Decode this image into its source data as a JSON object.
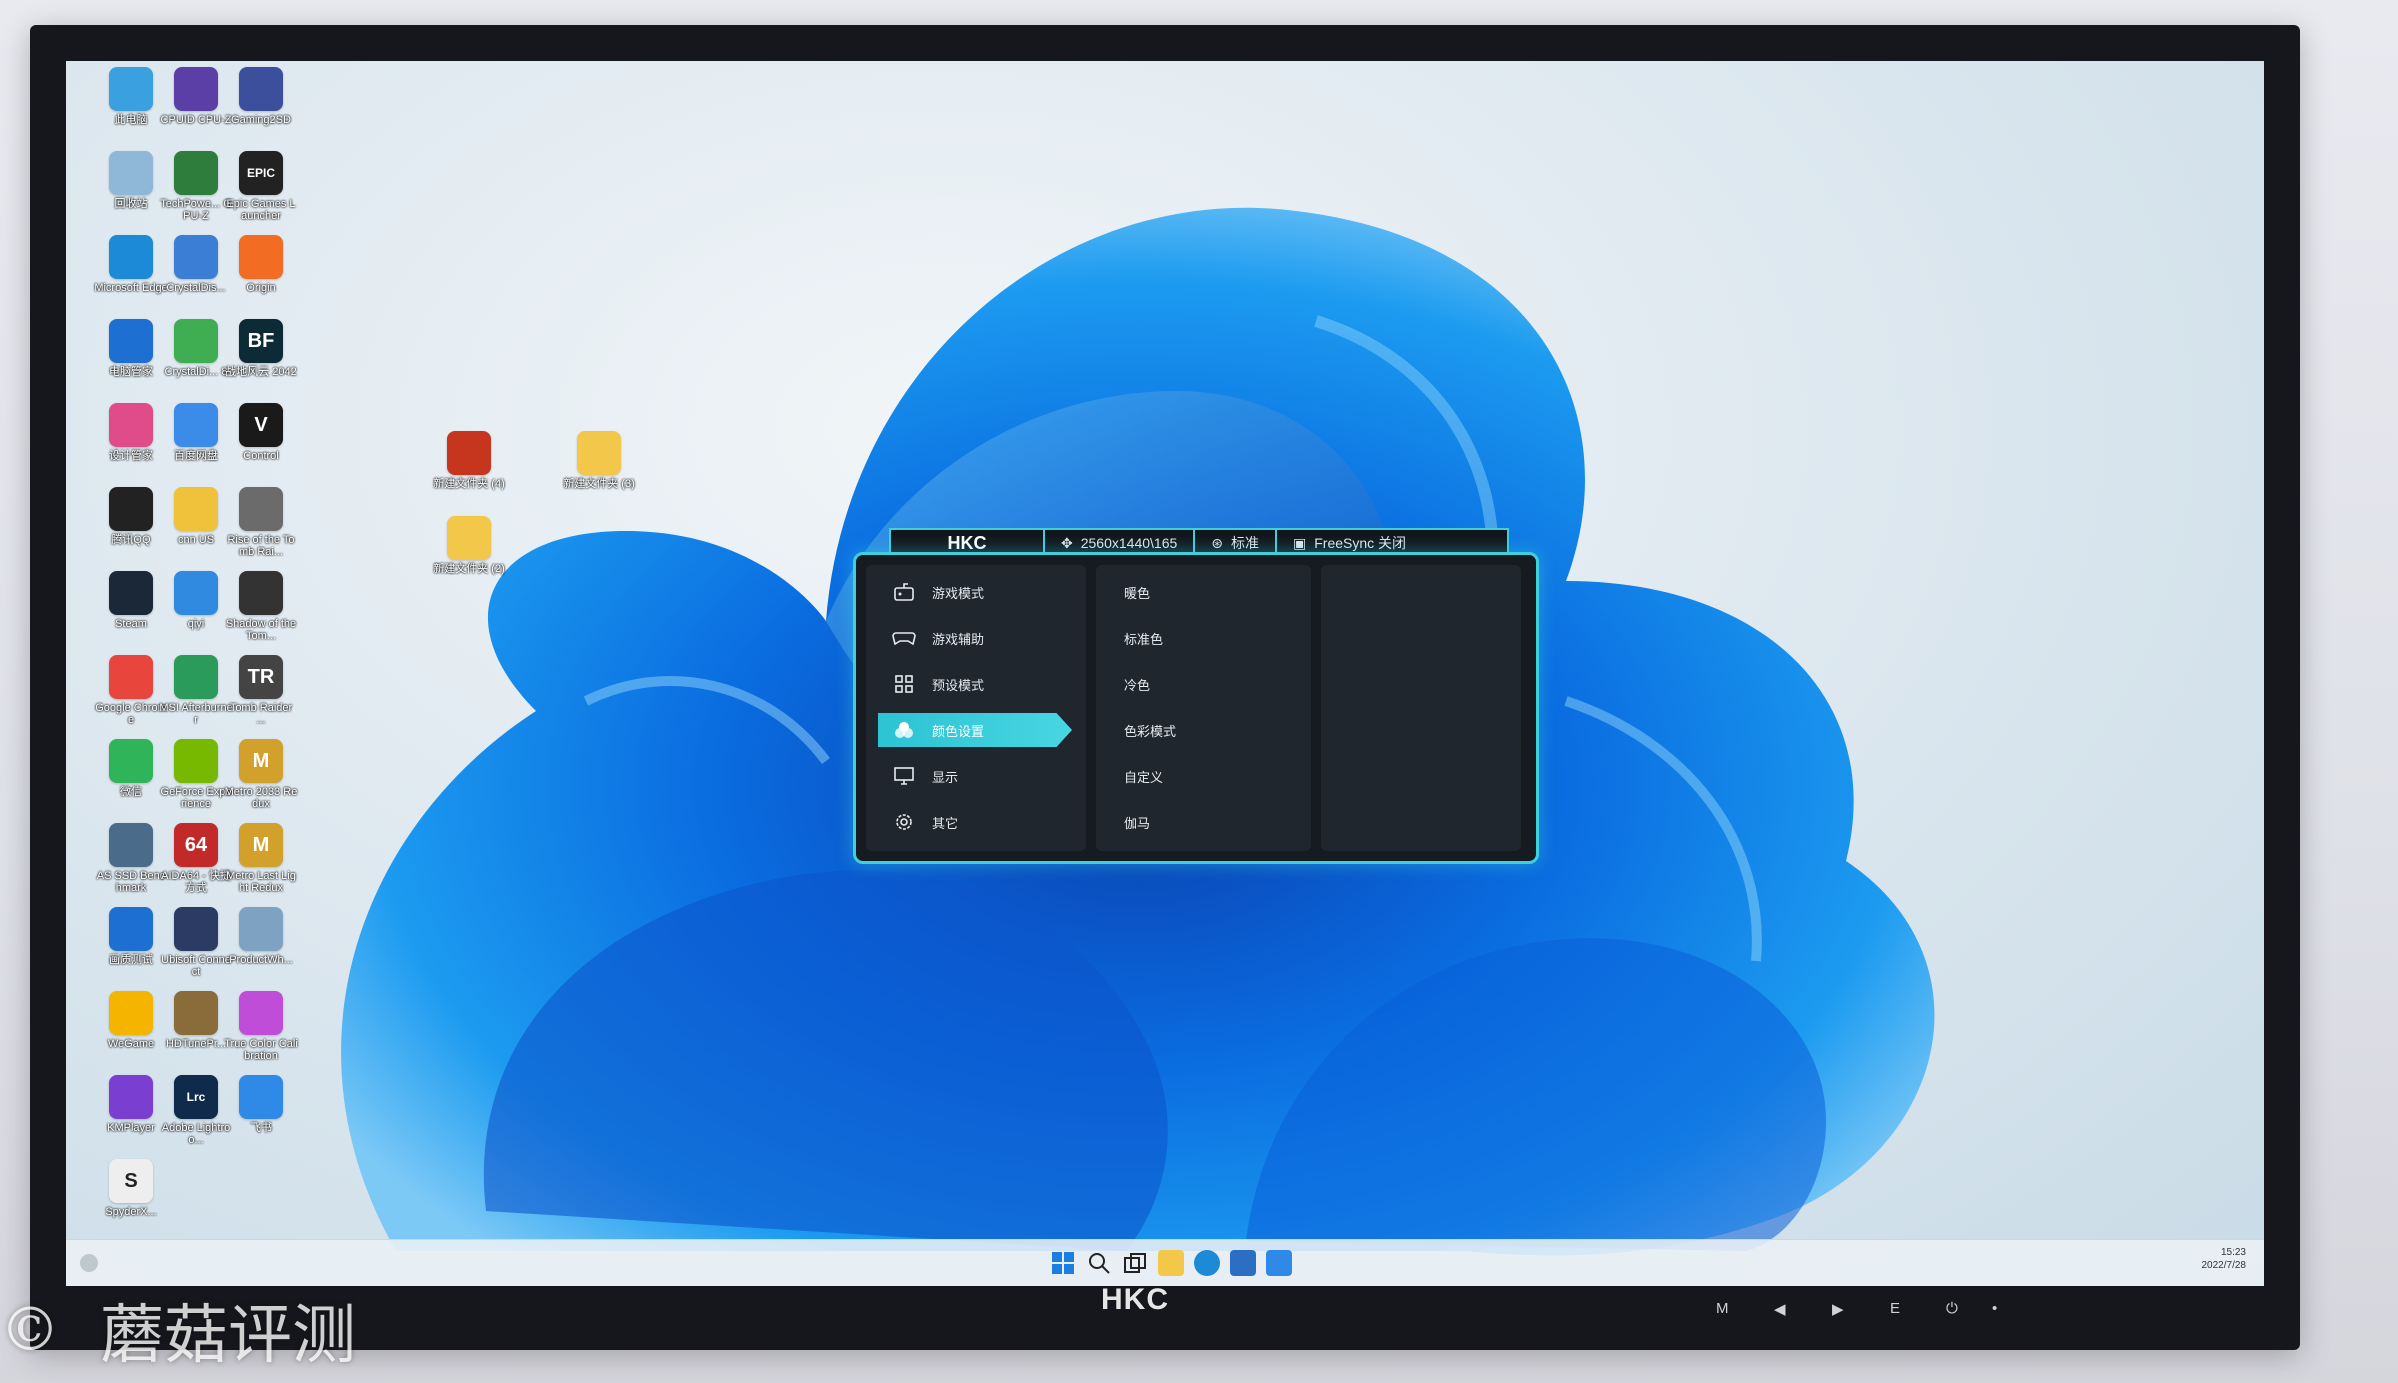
{
  "osd": {
    "brand": "HKC",
    "resolution": "2560x1440\\165",
    "mode": "标准",
    "freesync": "FreeSync 关闭",
    "menu": [
      {
        "label": "游戏模式",
        "icon": "gamepad-icon"
      },
      {
        "label": "游戏辅助",
        "icon": "controller-icon"
      },
      {
        "label": "预设模式",
        "icon": "grid-icon"
      },
      {
        "label": "颜色设置",
        "icon": "color-icon",
        "active": true
      },
      {
        "label": "显示",
        "icon": "monitor-icon"
      },
      {
        "label": "其它",
        "icon": "gear-icon"
      }
    ],
    "submenu": [
      "暖色",
      "标准色",
      "冷色",
      "色彩模式",
      "自定义",
      "伽马"
    ]
  },
  "desktop": {
    "icons": [
      {
        "label": "此电脑",
        "color": "#3aa0e0"
      },
      {
        "label": "CPUID CPU-Z",
        "color": "#5b3fa6"
      },
      {
        "label": "Gaming2SD",
        "color": "#3b4f9c"
      },
      {
        "label": "回收站",
        "color": "#8fb8d8"
      },
      {
        "label": "TechPowe... GPU-Z",
        "color": "#2e7d3c"
      },
      {
        "label": "Epic Games Launcher",
        "color": "#222222",
        "glyph": "EPIC"
      },
      {
        "label": "Microsoft Edge",
        "color": "#1c8ad6"
      },
      {
        "label": "CrystalDis...",
        "color": "#3a7ed6"
      },
      {
        "label": "Origin",
        "color": "#f26c23"
      },
      {
        "label": "电脑管家",
        "color": "#1d6fd1"
      },
      {
        "label": "CrystalDi... 8",
        "color": "#3fae52"
      },
      {
        "label": "战地风云 2042",
        "color": "#0d2b36",
        "glyph": "BF"
      },
      {
        "label": "设计管家",
        "color": "#e04c8a"
      },
      {
        "label": "百度网盘",
        "color": "#3b8be8"
      },
      {
        "label": "Control",
        "color": "#1a1a1a",
        "glyph": "V"
      },
      {
        "label": "腾讯QQ",
        "color": "#222222"
      },
      {
        "label": "cnn US",
        "color": "#f0c23b"
      },
      {
        "label": "Rise of the Tomb Rai...",
        "color": "#6b6b6b"
      },
      {
        "label": "Steam",
        "color": "#1b2838"
      },
      {
        "label": "qiyi",
        "color": "#2f8ae0"
      },
      {
        "label": "Shadow of the Tom...",
        "color": "#333333"
      },
      {
        "label": "Google Chrome",
        "color": "#e8453c"
      },
      {
        "label": "MSI Afterburner",
        "color": "#2b9b5b"
      },
      {
        "label": "Tomb Raider ...",
        "color": "#444444",
        "glyph": "TR"
      },
      {
        "label": "微信",
        "color": "#2fb45a"
      },
      {
        "label": "GeForce Experience",
        "color": "#76b900"
      },
      {
        "label": "Metro 2033 Redux",
        "color": "#d2a12c",
        "glyph": "M"
      },
      {
        "label": "AS SSD Benchmark",
        "color": "#4a6b8a"
      },
      {
        "label": "AIDA64 - 快捷方式",
        "color": "#c22a2a",
        "glyph": "64"
      },
      {
        "label": "Metro Last Light Redux",
        "color": "#d2a12c",
        "glyph": "M"
      },
      {
        "label": "画质测试",
        "color": "#1d6fd1"
      },
      {
        "label": "Ubisoft Connect",
        "color": "#2b3b63"
      },
      {
        "label": "ProductWh...",
        "color": "#7ea2c2"
      },
      {
        "label": "WeGame",
        "color": "#f5b400"
      },
      {
        "label": "HDTunePr...",
        "color": "#8a6b3a"
      },
      {
        "label": "True Color Calibration",
        "color": "#c04dd8"
      },
      {
        "label": "KMPlayer",
        "color": "#7a3fd0"
      },
      {
        "label": "Adobe Lightroo...",
        "color": "#0f2a4a",
        "glyph": "Lrc"
      },
      {
        "label": "飞书",
        "color": "#2e8ae6"
      },
      {
        "label": "SpyderX...",
        "color": "#eeeeee",
        "glyph": "S"
      }
    ],
    "extra_icons": [
      {
        "label": "新建文件夹 (4)",
        "color": "#c6361f"
      },
      {
        "label": "新建文件夹 (3)",
        "color": "#f3c84a"
      },
      {
        "label": "新建文件夹 (2)",
        "color": "#f3c84a"
      }
    ]
  },
  "taskbar": {
    "time": "15:23",
    "date": "2022/7/28"
  },
  "bezel": {
    "logo": "HKC",
    "buttons": [
      "M",
      "◀",
      "▶",
      "E",
      "⏻",
      "•"
    ]
  },
  "watermark": {
    "copyright": "©",
    "text": "蘑菇评测"
  }
}
